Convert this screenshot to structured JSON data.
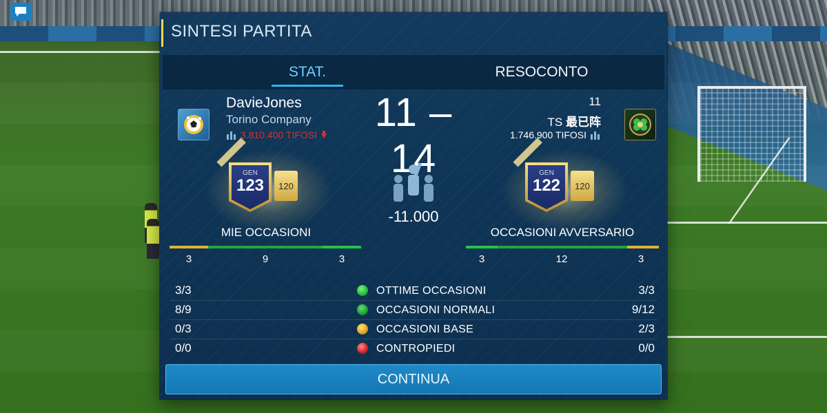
{
  "panel": {
    "title": "SINTESI PARTITA"
  },
  "tabs": [
    {
      "label": "STAT."
    },
    {
      "label": "RESOCONTO"
    }
  ],
  "player": {
    "name": "DavieJones",
    "club": "Torino Company",
    "fans": "3.810.400 TIFOSI"
  },
  "score": "11 – 14",
  "opponent": {
    "level": "11",
    "club_prefix": "TS ",
    "club_name": "最已阵",
    "fans": "1.746.900 TIFOSI"
  },
  "my_badge": {
    "gen": "GEN",
    "ovr": "123",
    "card": "120"
  },
  "opp_badge": {
    "gen": "GEN",
    "ovr": "122",
    "card": "120"
  },
  "fans_delta": "-11.000",
  "occasions": {
    "mine_title": "MIE OCCASIONI",
    "opp_title": "OCCASIONI AVVERSARIO",
    "mine": [
      3,
      9,
      3
    ],
    "opp": [
      3,
      12,
      3
    ]
  },
  "stats": [
    {
      "label": "OTTIME OCCASIONI",
      "mine": "3/3",
      "opp": "3/3",
      "ball_color": "#27c23f"
    },
    {
      "label": "OCCASIONI NORMALI",
      "mine": "8/9",
      "opp": "9/12",
      "ball_color": "#1fa83a"
    },
    {
      "label": "OCCASIONI BASE",
      "mine": "0/3",
      "opp": "2/3",
      "ball_color": "#e0a82a"
    },
    {
      "label": "CONTROPIEDI",
      "mine": "0/0",
      "opp": "0/0",
      "ball_color": "#d92a2a"
    }
  ],
  "continue_label": "CONTINUA",
  "colors": {
    "accent": "#2fb6f2",
    "fans_negative": "#d8312f",
    "bar_yellow": "#e0b23a",
    "bar_green": "#26c24a",
    "button": "#1f8ac8"
  }
}
